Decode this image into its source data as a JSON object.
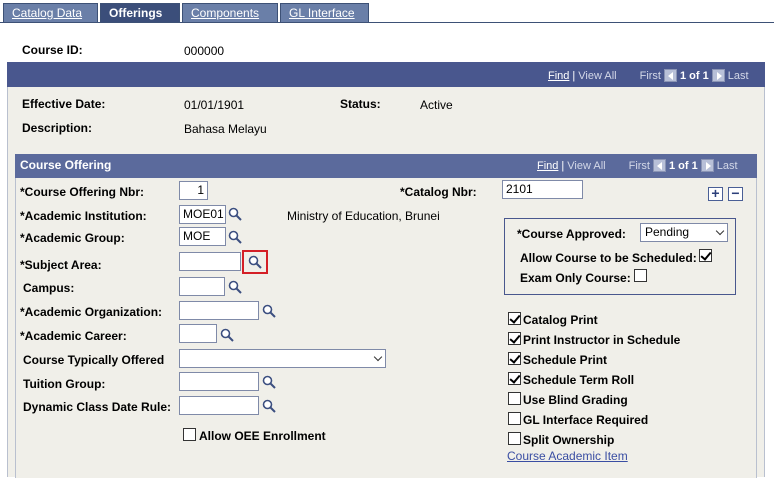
{
  "tabs": [
    {
      "label": "Catalog Data",
      "active": false
    },
    {
      "label": "Offerings",
      "active": true
    },
    {
      "label": "Components",
      "active": false
    },
    {
      "label": "GL Interface",
      "active": false
    }
  ],
  "course_id": {
    "label": "Course ID:",
    "value": "000000"
  },
  "effdt_nav": {
    "find": "Find",
    "sep": "|",
    "view_all": "View All",
    "first": "First",
    "count": "1 of 1",
    "last": "Last"
  },
  "header": {
    "effective_date_label": "Effective Date:",
    "effective_date_value": "01/01/1901",
    "status_label": "Status:",
    "status_value": "Active",
    "description_label": "Description:",
    "description_value": "Bahasa Melayu"
  },
  "offering": {
    "section_title": "Course Offering",
    "nav": {
      "find": "Find",
      "sep": "|",
      "view_all": "View All",
      "first": "First",
      "count": "1 of 1",
      "last": "Last"
    },
    "offering_nbr_label": "*Course Offering Nbr:",
    "offering_nbr_value": "1",
    "catalog_nbr_label": "*Catalog Nbr:",
    "catalog_nbr_value": "2101",
    "institution_label": "*Academic Institution:",
    "institution_value": "MOE01",
    "institution_desc": "Ministry of Education, Brunei",
    "group_label": "*Academic Group:",
    "group_value": "MOE",
    "subject_label": "*Subject Area:",
    "subject_value": "",
    "campus_label": "Campus:",
    "campus_value": "",
    "org_label": "*Academic Organization:",
    "org_value": "",
    "career_label": "*Academic Career:",
    "career_value": "",
    "typically_offered_label": "Course Typically Offered",
    "typically_offered_value": "",
    "tuition_group_label": "Tuition Group:",
    "tuition_group_value": "",
    "dynamic_rule_label": "Dynamic Class Date Rule:",
    "dynamic_rule_value": "",
    "allow_oee_label": "Allow OEE Enrollment",
    "course_approved_label": "*Course Approved:",
    "course_approved_value": "Pending",
    "allow_scheduled_label": "Allow Course to be Scheduled:",
    "exam_only_label": "Exam Only Course:",
    "add_symbol": "+",
    "remove_symbol": "−",
    "checkboxes": [
      {
        "label": "Catalog Print",
        "checked": true
      },
      {
        "label": "Print Instructor in Schedule",
        "checked": true
      },
      {
        "label": "Schedule Print",
        "checked": true
      },
      {
        "label": "Schedule Term Roll",
        "checked": true
      },
      {
        "label": "Use Blind Grading",
        "checked": false
      },
      {
        "label": "GL Interface Required",
        "checked": false
      },
      {
        "label": "Split Ownership",
        "checked": false
      }
    ],
    "academic_item_link": "Course Academic Item"
  },
  "colors": {
    "header_bar": "#49578e",
    "panel_bg": "#f0efe9",
    "highlight": "#d41f26",
    "link": "#3a4ea3"
  },
  "icons": [
    "lookup-magnifier-icon",
    "first-arrow-icon",
    "last-arrow-icon",
    "add-row-icon",
    "delete-row-icon"
  ]
}
